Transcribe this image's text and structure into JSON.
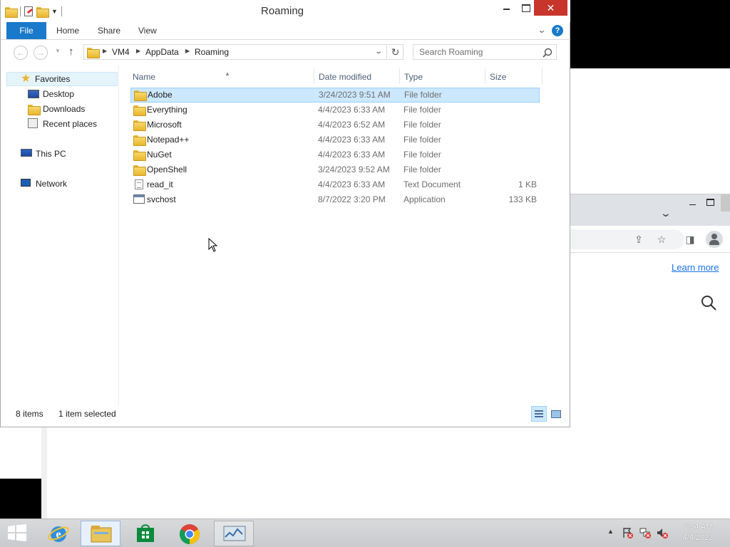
{
  "window": {
    "title": "Roaming",
    "close_glyph": "✕"
  },
  "ribbon": {
    "file": "File",
    "home": "Home",
    "share": "Share",
    "view": "View",
    "help": "?"
  },
  "address": {
    "crumbs": [
      "VM4",
      "AppData",
      "Roaming"
    ],
    "search_placeholder": "Search Roaming"
  },
  "navpane": {
    "favorites": "Favorites",
    "desktop": "Desktop",
    "downloads": "Downloads",
    "recent": "Recent places",
    "this_pc": "This PC",
    "network": "Network"
  },
  "columns": {
    "name": "Name",
    "date": "Date modified",
    "type": "Type",
    "size": "Size"
  },
  "files": [
    {
      "name": "Adobe",
      "date": "3/24/2023 9:51 AM",
      "type": "File folder",
      "size": "",
      "icon": "folder-icon",
      "selected": true
    },
    {
      "name": "Everything",
      "date": "4/4/2023 6:33 AM",
      "type": "File folder",
      "size": "",
      "icon": "folder-icon"
    },
    {
      "name": "Microsoft",
      "date": "4/4/2023 6:52 AM",
      "type": "File folder",
      "size": "",
      "icon": "folder-icon"
    },
    {
      "name": "Notepad++",
      "date": "4/4/2023 6:33 AM",
      "type": "File folder",
      "size": "",
      "icon": "folder-icon"
    },
    {
      "name": "NuGet",
      "date": "4/4/2023 6:33 AM",
      "type": "File folder",
      "size": "",
      "icon": "folder-icon"
    },
    {
      "name": "OpenShell",
      "date": "3/24/2023 9:52 AM",
      "type": "File folder",
      "size": "",
      "icon": "folder-icon"
    },
    {
      "name": "read_it",
      "date": "4/4/2023 6:33 AM",
      "type": "Text Document",
      "size": "1 KB",
      "icon": "text-document-icon"
    },
    {
      "name": "svchost",
      "date": "8/7/2022 3:20 PM",
      "type": "Application",
      "size": "133 KB",
      "icon": "application-icon"
    }
  ],
  "status": {
    "count": "8 items",
    "selected": "1 item selected"
  },
  "background": {
    "learn_more": "Learn more"
  },
  "taskbar": {
    "time": "6:54 AM",
    "date": "4/4/2023"
  },
  "colors": {
    "accent": "#1979ca",
    "selection": "#cce8ff",
    "close": "#c7352b"
  }
}
